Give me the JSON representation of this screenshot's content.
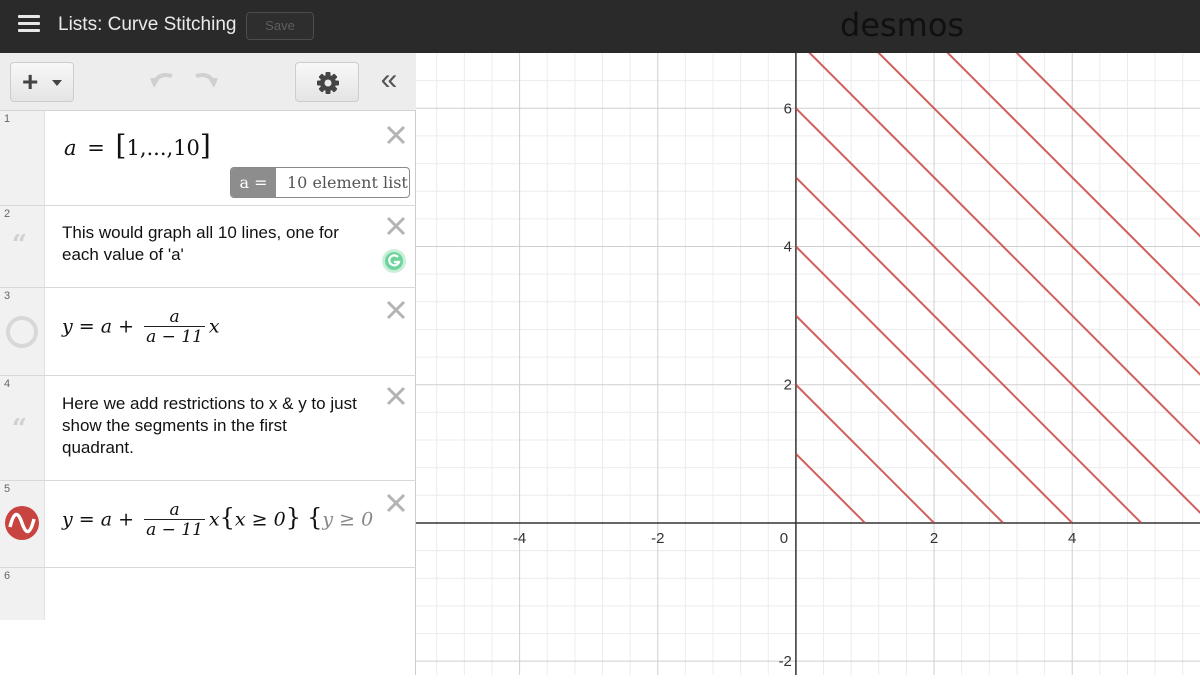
{
  "header": {
    "title": "Lists: Curve Stitching",
    "save_label": "Save",
    "logo": "desmos"
  },
  "toolbar": {
    "add_icon": "plus-icon",
    "undo_icon": "undo-icon",
    "redo_icon": "redo-icon",
    "settings_icon": "gear-icon",
    "collapse_label": "«"
  },
  "expressions": {
    "e1": {
      "num": "1",
      "lhs": "a",
      "eq": "=",
      "list": "1,...,10",
      "badge_var": "a =",
      "badge_value": "10 element list"
    },
    "e2": {
      "num": "2",
      "text": "This would graph all 10 lines, one for each value of 'a'"
    },
    "e3": {
      "num": "3",
      "y": "y",
      "eq": "=",
      "a": "a",
      "plus": "+",
      "numer": "a",
      "denom": "a − 11",
      "x": "x"
    },
    "e4": {
      "num": "4",
      "text": "Here we add restrictions to x & y to just show the segments in the first quadrant."
    },
    "e5": {
      "num": "5",
      "y": "y",
      "eq": "=",
      "a": "a",
      "plus": "+",
      "numer": "a",
      "denom": "a − 11",
      "x": "x",
      "r1": "x ≥ 0",
      "r2": "y ≥ 0"
    },
    "e6": {
      "num": "6"
    }
  },
  "graph": {
    "x_ticks": [
      "-4",
      "-2",
      "0",
      "2",
      "4"
    ],
    "y_ticks": [
      "6",
      "4",
      "2",
      "-2"
    ],
    "line_color": "#c74440"
  },
  "chart_data": {
    "type": "line",
    "xlim": [
      -5.5,
      5.85
    ],
    "ylim": [
      -2.2,
      6.8
    ],
    "grid": true,
    "series": [
      {
        "a": 1,
        "x": [
          0,
          1
        ],
        "y": [
          1,
          0
        ]
      },
      {
        "a": 2,
        "x": [
          0,
          2
        ],
        "y": [
          2,
          0
        ]
      },
      {
        "a": 3,
        "x": [
          0,
          3
        ],
        "y": [
          3,
          0
        ]
      },
      {
        "a": 4,
        "x": [
          0,
          4
        ],
        "y": [
          4,
          0
        ]
      },
      {
        "a": 5,
        "x": [
          0,
          5
        ],
        "y": [
          5,
          0
        ]
      },
      {
        "a": 6,
        "x": [
          0,
          6
        ],
        "y": [
          6,
          0
        ]
      },
      {
        "a": 7,
        "x": [
          0,
          7
        ],
        "y": [
          7,
          0
        ]
      },
      {
        "a": 8,
        "x": [
          0,
          8
        ],
        "y": [
          8,
          0
        ]
      },
      {
        "a": 9,
        "x": [
          0,
          9
        ],
        "y": [
          9,
          0
        ]
      },
      {
        "a": 10,
        "x": [
          0,
          10
        ],
        "y": [
          10,
          0
        ]
      }
    ]
  }
}
